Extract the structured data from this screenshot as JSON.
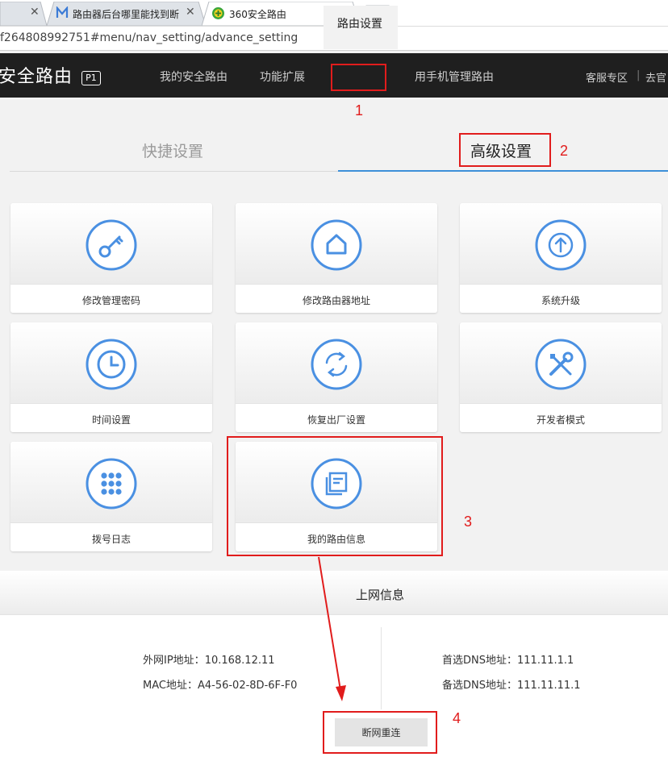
{
  "browser": {
    "tabs": [
      {
        "title": "",
        "close": "✕"
      },
      {
        "title": "路由器后台哪里能找到断",
        "close": "✕"
      },
      {
        "title": "360安全路由",
        "close": "✕"
      }
    ],
    "url": "f264808992751#menu/nav_setting/advance_setting"
  },
  "header": {
    "logo": "安全路由",
    "badge": "P1",
    "nav": [
      "我的安全路由",
      "功能扩展",
      "路由设置",
      "用手机管理路由"
    ],
    "active_nav": "路由设置",
    "right_links": [
      "客服专区",
      "去官"
    ]
  },
  "settings_tabs": {
    "quick": "快捷设置",
    "advanced": "高级设置"
  },
  "tiles": [
    {
      "label": "修改管理密码",
      "icon": "key-icon"
    },
    {
      "label": "修改路由器地址",
      "icon": "home-icon"
    },
    {
      "label": "系统升级",
      "icon": "upgrade-icon"
    },
    {
      "label": "时间设置",
      "icon": "clock-icon"
    },
    {
      "label": "恢复出厂设置",
      "icon": "restore-icon"
    },
    {
      "label": "开发者模式",
      "icon": "tools-icon"
    },
    {
      "label": "拨号日志",
      "icon": "dialpad-icon"
    },
    {
      "label": "我的路由信息",
      "icon": "info-card-icon"
    }
  ],
  "online_info": {
    "title": "上网信息",
    "wan_ip_label": "外网IP地址：",
    "wan_ip": "10.168.12.11",
    "mac_label": "MAC地址：",
    "mac": "A4-56-02-8D-6F-F0",
    "dns1_label": "首选DNS地址：",
    "dns1": "111.11.1.1",
    "dns2_label": "备选DNS地址：",
    "dns2": "111.11.11.1",
    "disconnect_button": "断网重连"
  },
  "annotations": [
    "1",
    "2",
    "3",
    "4"
  ],
  "colors": {
    "accent": "#4a90e2",
    "header_bg": "#1f1f1f",
    "annotation": "#e11c1c",
    "underline": "#3d8fd9"
  }
}
